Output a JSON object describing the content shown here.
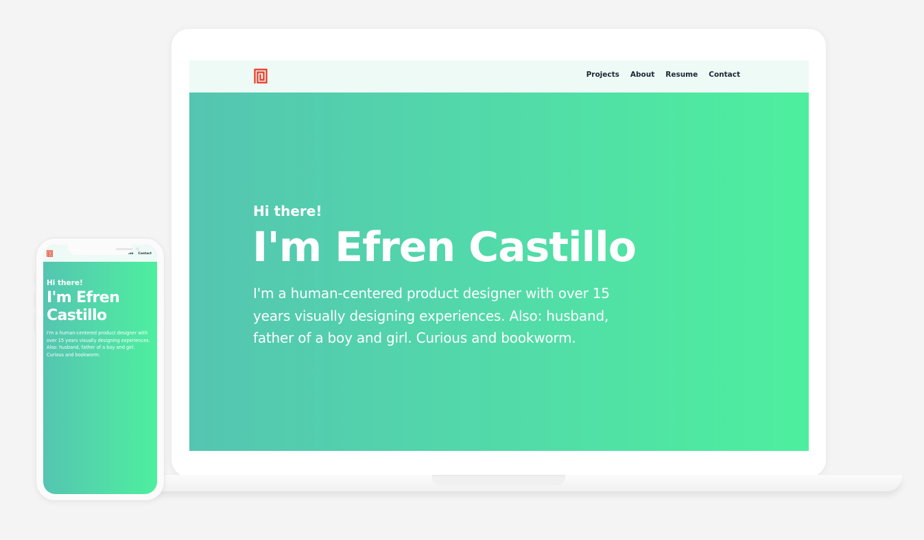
{
  "colors": {
    "background": "#f4f4f4",
    "gradient_start": "#54c5b1",
    "gradient_end": "#4def9e",
    "nav_background": "#eefaf5",
    "nav_text": "#1a2533",
    "logo": "#e8432e"
  },
  "icons": {
    "logo": "square-spiral-logo-icon"
  },
  "laptop": {
    "nav": {
      "items": [
        {
          "label": "Projects"
        },
        {
          "label": "About"
        },
        {
          "label": "Resume"
        },
        {
          "label": "Contact"
        }
      ]
    },
    "hero": {
      "greeting": "Hi there!",
      "name": "I'm Efren Castillo",
      "bio_lines": [
        "I'm a human-centered product designer with over 15",
        "years visually designing experiences. Also: husband,",
        "father of a boy and girl. Curious and bookworm."
      ]
    }
  },
  "phone": {
    "nav": {
      "items": [
        {
          "label": "me"
        },
        {
          "label": "Contact"
        }
      ]
    },
    "hero": {
      "greeting": "Hi there!",
      "name_lines": [
        "I'm Efren",
        "Castillo"
      ],
      "bio_lines": [
        "I'm a human-centered product designer with",
        "over 15 years visually designing experiences.",
        "Also: husband, father of a boy and girl.",
        "Curious and bookworm."
      ]
    }
  }
}
